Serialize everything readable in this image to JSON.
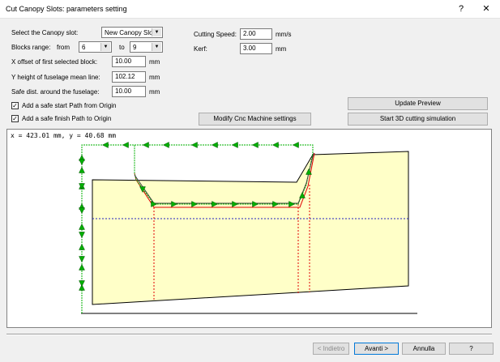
{
  "window": {
    "title": "Cut Canopy Slots: parameters setting",
    "help_glyph": "?",
    "close_glyph": "✕"
  },
  "form": {
    "slot_label": "Select the Canopy slot:",
    "slot_value": "New Canopy Slot",
    "blocks_label": "Blocks range:",
    "from_label": "from",
    "from_value": "6",
    "to_label": "to",
    "to_value": "9",
    "xoffset_label": "X offset of first selected block:",
    "xoffset_value": "10.00",
    "xoffset_unit": "mm",
    "yheight_label": "Y height of fuselage mean line:",
    "yheight_value": "102.12",
    "yheight_unit": "mm",
    "safe_label": "Safe dist. around the fuselage:",
    "safe_value": "10.00",
    "safe_unit": "mm",
    "start_path_label": "Add a safe start Path from Origin",
    "start_path_checked": true,
    "finish_path_label": "Add a safe finish Path to Origin",
    "finish_path_checked": true,
    "speed_label": "Cutting Speed:",
    "speed_value": "2.00",
    "speed_unit": "mm/s",
    "kerf_label": "Kerf:",
    "kerf_value": "3.00",
    "kerf_unit": "mm"
  },
  "buttons": {
    "update_preview": "Update Preview",
    "start_sim": "Start 3D cutting simulation",
    "modify_cnc": "Modify Cnc Machine settings",
    "back": "< Indietro",
    "next": "Avanti >",
    "cancel": "Annulla",
    "help": "?"
  },
  "preview": {
    "coord_readout": "x = 423.01 mm, y = 40.68 mm"
  },
  "colors": {
    "fuselage_fill": "#ffffc8",
    "path_green": "#00b000",
    "kerf_red": "#e00000",
    "mean_line_blue": "#2020c0",
    "block_red": "#e00000"
  },
  "icons": {
    "checkbox": "check-mark",
    "combo_arrow": "dropdown-arrow",
    "path_arrow": "triangle-arrow"
  }
}
